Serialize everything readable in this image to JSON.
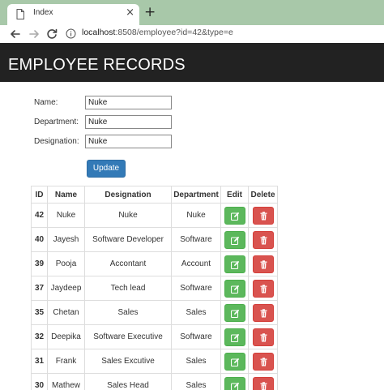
{
  "browser": {
    "tab_title": "Index",
    "close_glyph": "×",
    "new_tab_glyph": "+",
    "address_host": "localhost",
    "address_rest": ":8508/employee?id=42&type=e"
  },
  "header": {
    "title": "EMPLOYEE RECORDS"
  },
  "form": {
    "name_label": "Name:",
    "name_value": "Nuke",
    "department_label": "Department:",
    "department_value": "Nuke",
    "designation_label": "Designation:",
    "designation_value": "Nuke",
    "update_label": "Update"
  },
  "table": {
    "headers": [
      "ID",
      "Name",
      "Designation",
      "Department",
      "Edit",
      "Delete"
    ],
    "rows": [
      {
        "id": "42",
        "name": "Nuke",
        "designation": "Nuke",
        "department": "Nuke"
      },
      {
        "id": "40",
        "name": "Jayesh",
        "designation": "Software Developer",
        "department": "Software"
      },
      {
        "id": "39",
        "name": "Pooja",
        "designation": "Accontant",
        "department": "Account"
      },
      {
        "id": "37",
        "name": "Jaydeep",
        "designation": "Tech lead",
        "department": "Software"
      },
      {
        "id": "35",
        "name": "Chetan",
        "designation": "Sales",
        "department": "Sales"
      },
      {
        "id": "32",
        "name": "Deepika",
        "designation": "Software Executive",
        "department": "Software"
      },
      {
        "id": "31",
        "name": "Frank",
        "designation": "Sales Excutive",
        "department": "Sales"
      },
      {
        "id": "30",
        "name": "Mathew",
        "designation": "Sales Head",
        "department": "Sales"
      }
    ],
    "edit_icon": "pencil-square-icon",
    "delete_icon": "trash-icon"
  },
  "colors": {
    "tabstrip": "#a8c8a9",
    "header_bg": "#222222",
    "update_button": "#337ab7",
    "edit_button": "#5cb85c",
    "delete_button": "#d9534f"
  }
}
